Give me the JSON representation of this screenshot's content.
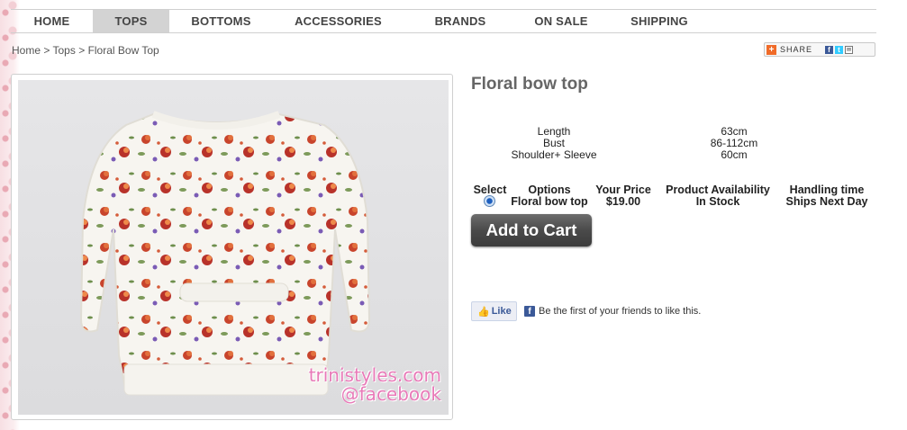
{
  "nav": {
    "items": [
      {
        "label": "HOME"
      },
      {
        "label": "TOPS"
      },
      {
        "label": "BOTTOMS"
      },
      {
        "label": "ACCESSORIES"
      },
      {
        "label": "BRANDS"
      },
      {
        "label": "ON SALE"
      },
      {
        "label": "SHIPPING"
      }
    ],
    "active": "TOPS"
  },
  "breadcrumb": {
    "home": "Home",
    "sep": ">",
    "category": "Tops",
    "current": "Floral Bow Top"
  },
  "share": {
    "label": "SHARE",
    "icons": [
      "addthis-plus-icon",
      "facebook-icon",
      "twitter-icon",
      "email-icon"
    ]
  },
  "product": {
    "title": "Floral bow top",
    "watermark_line1": "trinistyles.com",
    "watermark_line2": "@facebook",
    "specs": [
      {
        "label": "Length",
        "value": "63cm"
      },
      {
        "label": "Bust",
        "value": "86-112cm"
      },
      {
        "label": "Shoulder+ Sleeve",
        "value": "60cm"
      }
    ],
    "options_table": {
      "headers": {
        "select": "Select",
        "options": "Options",
        "price": "Your Price",
        "availability": "Product Availability",
        "handling": "Handling time"
      },
      "row": {
        "option": "Floral bow top",
        "price": "$19.00",
        "availability": "In Stock",
        "handling": "Ships Next Day",
        "selected": true
      }
    },
    "add_to_cart": "Add to Cart"
  },
  "facebook": {
    "like_label": "Like",
    "like_text": "Be the first of your friends to like this."
  },
  "colors": {
    "nav_active_bg": "#d3d3d3",
    "button_dark": "#4a4a4a",
    "facebook_blue": "#3b5998",
    "watermark_pink": "#e87ab8"
  }
}
